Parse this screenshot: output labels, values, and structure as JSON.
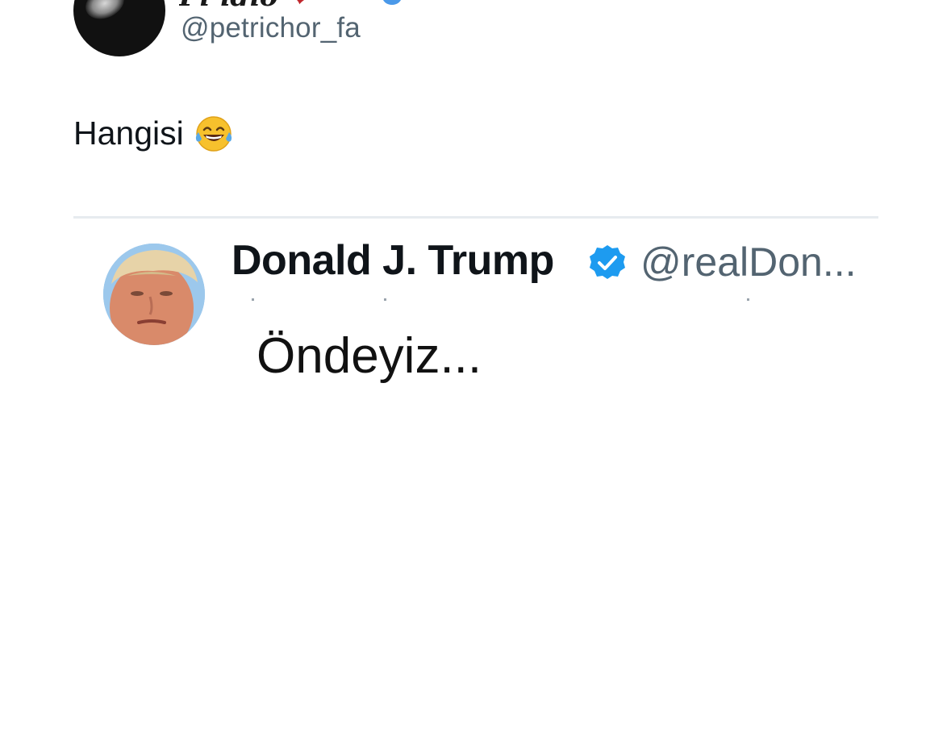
{
  "author": {
    "display_name": "Pi ıdıo",
    "handle": "@petrichor_fa"
  },
  "tweet": {
    "text": "Hangisi",
    "emoji_icon": "face-with-tears-of-joy-icon"
  },
  "quoted_screenshot": {
    "name": "Donald J. Trump",
    "handle": "@realDon...",
    "text": "Öndeyiz...",
    "verified_color": "#1d9bf0"
  },
  "colors": {
    "handle_gray": "#536471",
    "text_dark": "#0f1419",
    "verified_blue": "#1d9bf0",
    "divider": "#e7ebef"
  }
}
